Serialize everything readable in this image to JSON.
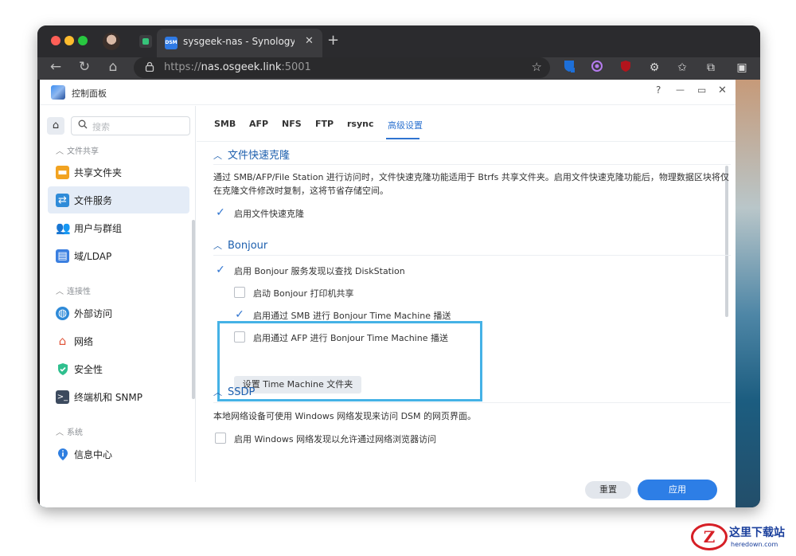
{
  "browser": {
    "tab_title": "sysgeek-nas - Synology DiskSt",
    "tab_favicon_text": "DSM",
    "url_scheme": "https://",
    "url_host": "nas.osgeek.link",
    "url_port": ":5001",
    "icons": {
      "back": "←",
      "reload": "↻",
      "home": "⌂",
      "lock": "🔒",
      "star": "☆",
      "close": "✕",
      "new_tab": "+"
    }
  },
  "dsm": {
    "app_title": "控制面板",
    "window_controls": {
      "help": "?",
      "minimize": "—",
      "maximize": "▭",
      "close": "✕"
    }
  },
  "sidebar": {
    "search_placeholder": "搜索",
    "sections": [
      {
        "title": "文件共享",
        "items": [
          {
            "label": "共享文件夹",
            "icon": "folder-icon",
            "color": "#f2a321"
          },
          {
            "label": "文件服务",
            "icon": "file-service-icon",
            "color": "#2f8bd8",
            "active": true
          },
          {
            "label": "用户与群组",
            "icon": "users-icon",
            "color": "#3a9fe0"
          },
          {
            "label": "域/LDAP",
            "icon": "ldap-icon",
            "color": "#3a7fe0"
          }
        ]
      },
      {
        "title": "连接性",
        "items": [
          {
            "label": "外部访问",
            "icon": "globe-icon",
            "color": "#2e8ad8"
          },
          {
            "label": "网络",
            "icon": "network-icon",
            "color": "#e0553a"
          },
          {
            "label": "安全性",
            "icon": "shield-icon",
            "color": "#2fbf8e"
          },
          {
            "label": "终端机和 SNMP",
            "icon": "terminal-icon",
            "color": "#3c4a5e"
          }
        ]
      },
      {
        "title": "系统",
        "items": [
          {
            "label": "信息中心",
            "icon": "info-icon",
            "color": "#2e7ee0"
          }
        ]
      }
    ]
  },
  "tabs": [
    "SMB",
    "AFP",
    "NFS",
    "FTP",
    "rsync",
    "高级设置"
  ],
  "groups": {
    "clone": {
      "title": "文件快速克隆",
      "description": "通过 SMB/AFP/File Station 进行访问时，文件快速克隆功能适用于 Btrfs 共享文件夹。启用文件快速克隆功能后，物理数据区块将仅在克隆文件修改时复制，这将节省存储空间。",
      "enable_label": "启用文件快速克隆"
    },
    "bonjour": {
      "title": "Bonjour",
      "enable_discovery": "启用 Bonjour 服务发现以查找 DiskStation",
      "printer_share": "启动 Bonjour 打印机共享",
      "smb_tm": "启用通过 SMB 进行 Bonjour Time Machine 播送",
      "afp_tm": "启用通过 AFP 进行 Bonjour Time Machine 播送",
      "set_folder_button": "设置 Time Machine 文件夹"
    },
    "ssdp": {
      "title": "SSDP",
      "description": "本地网络设备可使用 Windows 网络发现来访问 DSM 的网页界面。",
      "enable_label": "启用 Windows 网络发现以允许通过网络浏览器访问"
    }
  },
  "footer": {
    "reset_label": "重置",
    "apply_label": "应用"
  },
  "watermark": {
    "logo": "Z",
    "cn": "这里下载站",
    "en": "heredown.com"
  }
}
